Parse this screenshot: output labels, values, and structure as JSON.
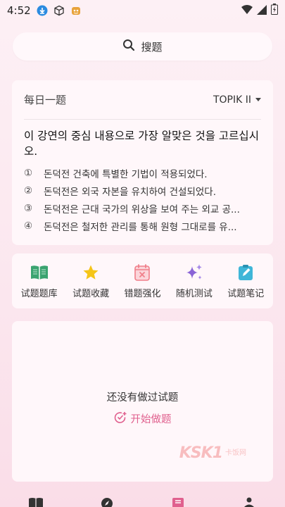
{
  "status": {
    "time": "4:52"
  },
  "search": {
    "label": "搜题"
  },
  "daily": {
    "title": "每日一题",
    "level": "TOPIK II",
    "question": "이 강연의 중심 내용으로 가장 알맞은 것을 고르십시오.",
    "options": [
      {
        "num": "①",
        "text": "돈덕전 건축에 특별한 기법이 적용되었다."
      },
      {
        "num": "②",
        "text": "돈덕전은 외국 자본을 유치하여 건설되었다."
      },
      {
        "num": "③",
        "text": "돈덕전은 근대 국가의 위상을 보여 주는 외교 공..."
      },
      {
        "num": "④",
        "text": "돈덕전은 철저한 관리를 통해 원형 그대로를 유..."
      }
    ]
  },
  "actions": [
    {
      "label": "试题题库",
      "icon": "book-icon",
      "color": "#3aa370"
    },
    {
      "label": "试题收藏",
      "icon": "star-icon",
      "color": "#f5c518"
    },
    {
      "label": "错题强化",
      "icon": "calendar-x-icon",
      "color": "#f07f8a"
    },
    {
      "label": "随机测试",
      "icon": "sparkle-icon",
      "color": "#8a63d6"
    },
    {
      "label": "试题笔记",
      "icon": "note-icon",
      "color": "#3fb6d8"
    }
  ],
  "empty": {
    "message": "还没有做过试题",
    "start_label": "开始做题"
  },
  "watermark": {
    "brand": "KSK1",
    "sub": "卡饭网"
  },
  "colors": {
    "accent": "#e0608e",
    "background": "#fbe6ee"
  }
}
